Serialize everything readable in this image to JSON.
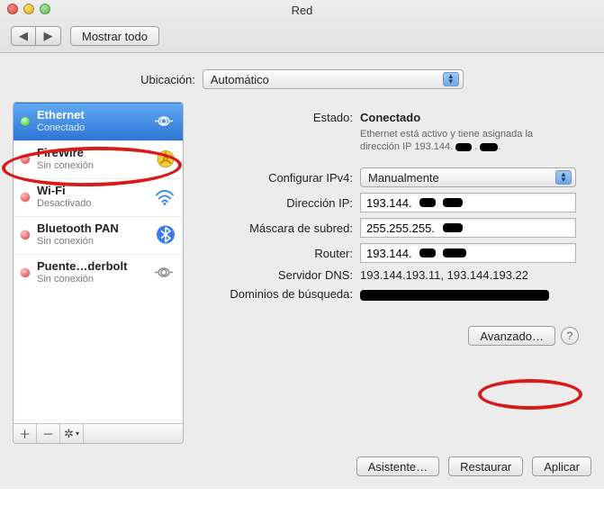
{
  "window": {
    "title": "Red"
  },
  "toolbar": {
    "show_all": "Mostrar todo"
  },
  "location": {
    "label": "Ubicación:",
    "value": "Automático"
  },
  "sidebar": {
    "items": [
      {
        "name": "Ethernet",
        "status": "Conectado",
        "dot": "green"
      },
      {
        "name": "FireWire",
        "status": "Sin conexión",
        "dot": "red"
      },
      {
        "name": "Wi-Fi",
        "status": "Desactivado",
        "dot": "red"
      },
      {
        "name": "Bluetooth PAN",
        "status": "Sin conexión",
        "dot": "red"
      },
      {
        "name": "Puente…derbolt",
        "status": "Sin conexión",
        "dot": "red"
      }
    ]
  },
  "detail": {
    "status_label": "Estado:",
    "status_value": "Conectado",
    "status_sub_a": "Ethernet está activo y tiene asignada la",
    "status_sub_b": "dirección IP 193.144.",
    "configure_label": "Configurar IPv4:",
    "configure_value": "Manualmente",
    "ip_label": "Dirección IP:",
    "ip_value": "193.144.",
    "mask_label": "Máscara de subred:",
    "mask_value": "255.255.255.",
    "router_label": "Router:",
    "router_value": "193.144.",
    "dns_label": "Servidor DNS:",
    "dns_value": "193.144.193.11, 193.144.193.22",
    "search_label": "Dominios de búsqueda:",
    "advanced": "Avanzado…"
  },
  "buttons": {
    "assistant": "Asistente…",
    "restore": "Restaurar",
    "apply": "Aplicar"
  }
}
